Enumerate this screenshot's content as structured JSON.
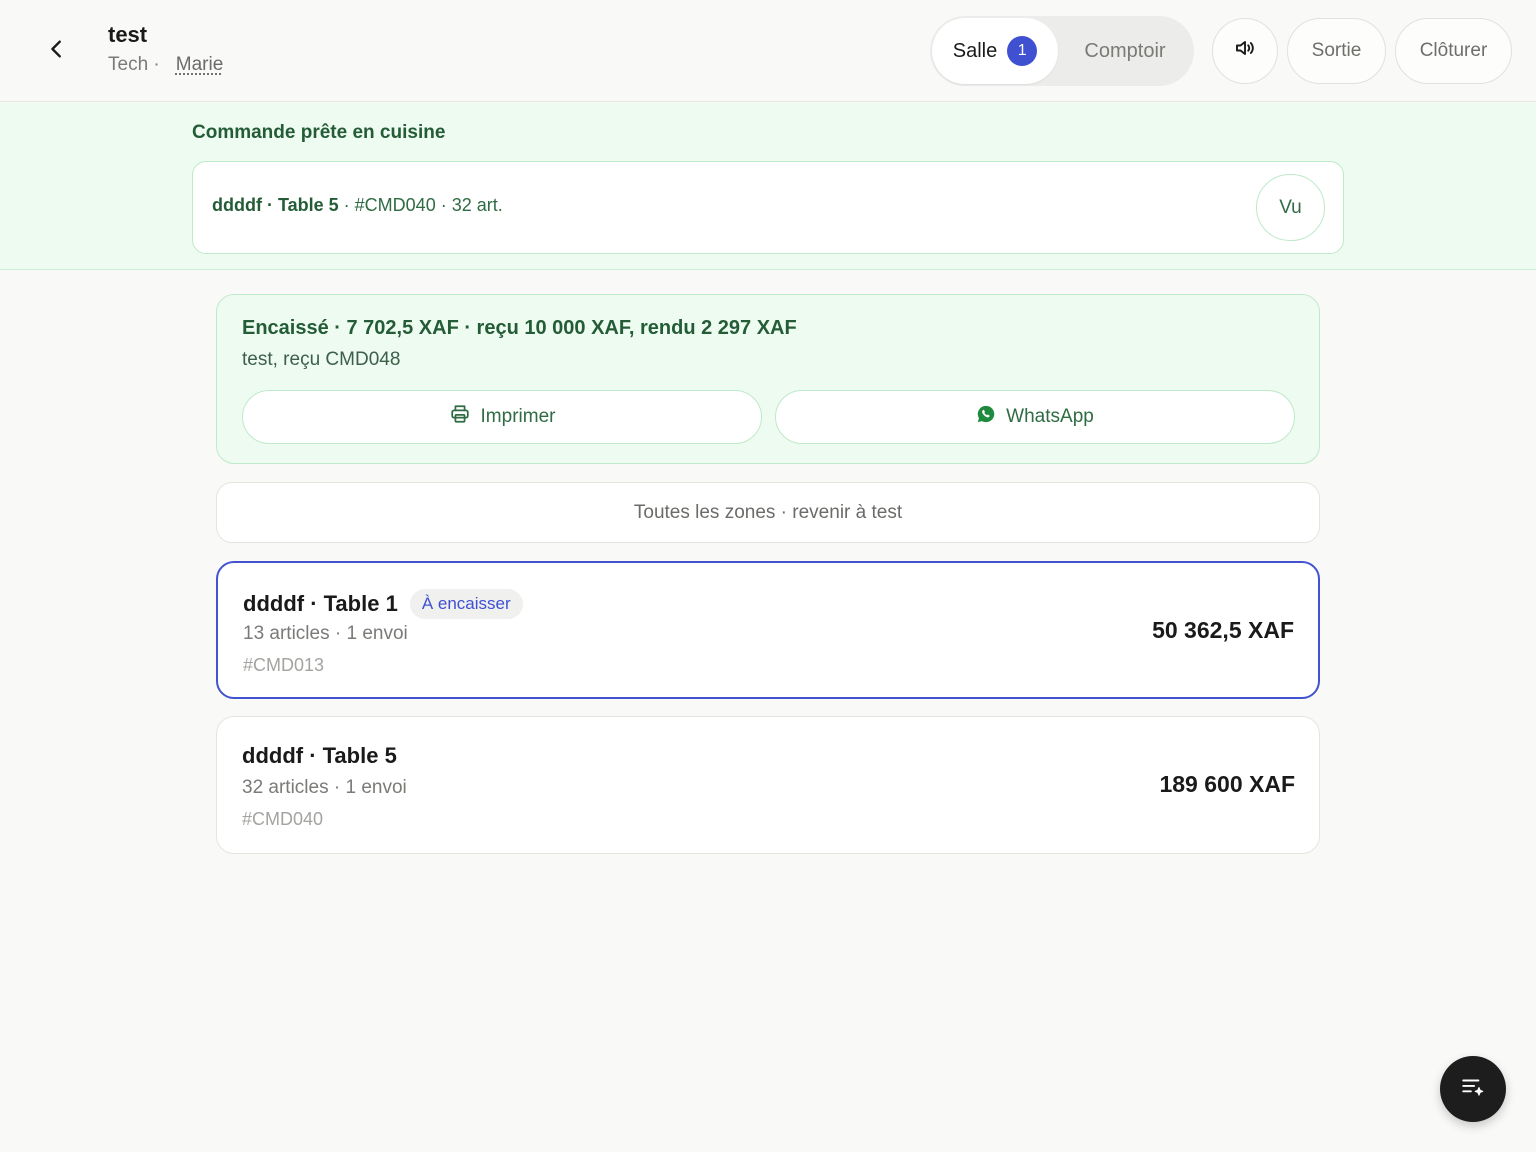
{
  "header": {
    "title": "test",
    "subtitle_prefix": "Tech ·",
    "user": "Marie",
    "segments": [
      {
        "label": "Salle",
        "count": "1"
      },
      {
        "label": "Comptoir"
      }
    ],
    "sortie_label": "Sortie",
    "cloturer_label": "Clôturer"
  },
  "kitchen": {
    "title": "Commande prête en cuisine",
    "order_bold": "ddddf · Table 5",
    "order_rest": " · #CMD040 · 32 art.",
    "seen_label": "Vu"
  },
  "payment": {
    "title": "Encaissé · 7 702,5 XAF · reçu 10 000 XAF, rendu 2 297 XAF",
    "subtitle": "test, reçu CMD048",
    "print_label": "Imprimer",
    "whatsapp_label": "WhatsApp"
  },
  "zones_link": "Toutes les zones · revenir à test",
  "orders": [
    {
      "title": "ddddf · Table 1",
      "status": "À encaisser",
      "meta": "13 articles · 1 envoi",
      "ref": "#CMD013",
      "amount": "50 362,5 XAF"
    },
    {
      "title": "ddddf · Table 5",
      "meta": "32 articles · 1 envoi",
      "ref": "#CMD040",
      "amount": "189 600 XAF"
    }
  ],
  "colors": {
    "accent": "#3f51d1",
    "success_text": "#245c37",
    "success_bg": "#eefbf0",
    "whatsapp": "#1f8a3e"
  },
  "icons": {
    "back": "chevron-left-icon",
    "sound": "speaker-icon",
    "print": "printer-icon",
    "whatsapp": "whatsapp-icon",
    "fab": "list-sparkle-icon"
  }
}
